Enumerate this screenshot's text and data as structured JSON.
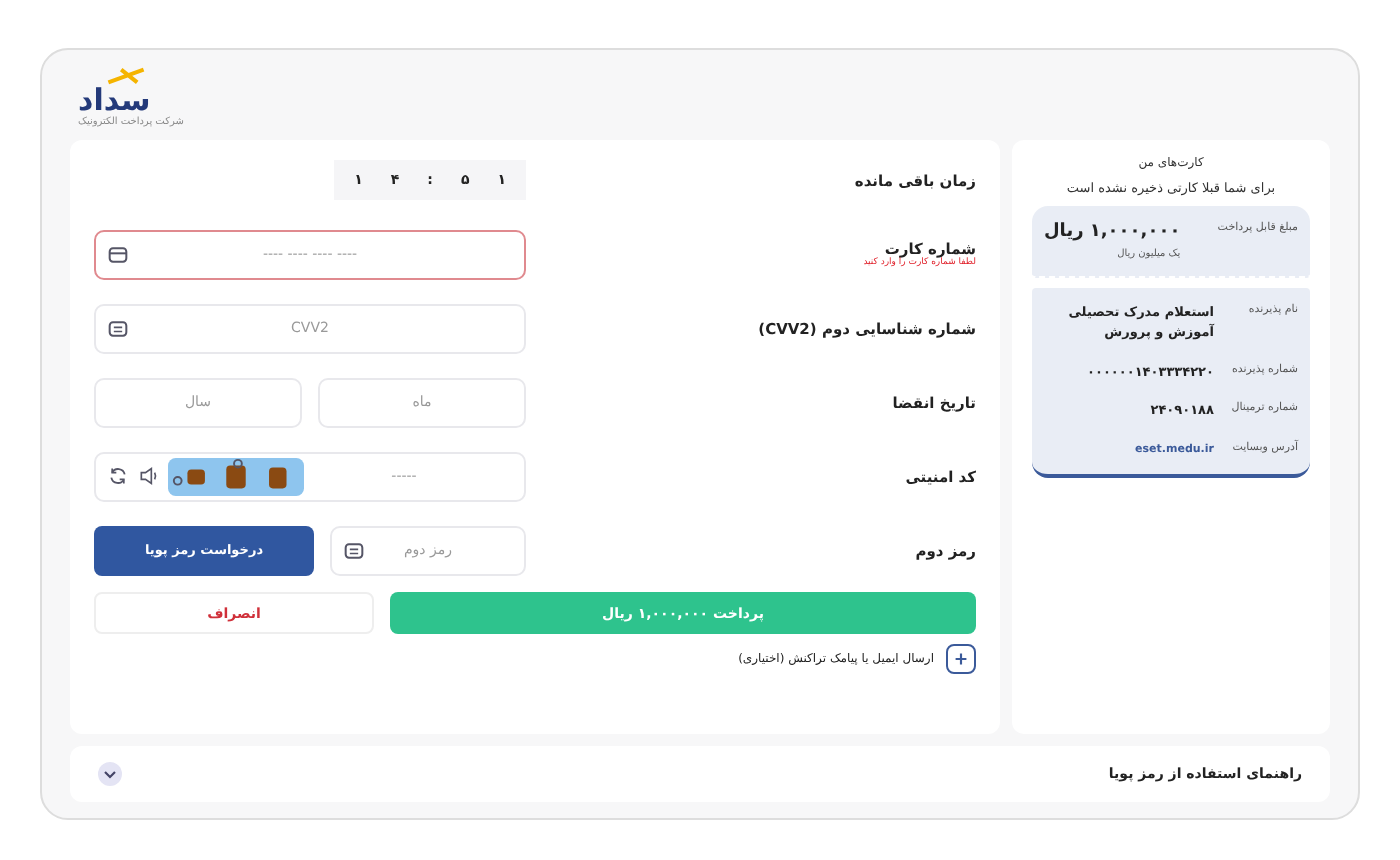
{
  "logo": {
    "name": "سداد",
    "subtitle": "شرکت پرداخت الکترونیک"
  },
  "saved_cards": {
    "title": "کارت‌های من",
    "message": "برای شما قبلا کارتی ذخیره نشده است"
  },
  "invoice": {
    "amount_label": "مبلغ قابل پرداخت",
    "amount": "۱,۰۰۰,۰۰۰ ریال",
    "amount_words": "یک میلیون ریال",
    "rows": [
      {
        "label": "نام پذیرنده",
        "value": "استعلام مدرک تحصیلی آموزش و پرورش",
        "kind": "text"
      },
      {
        "label": "شماره پذیرنده",
        "value": "۰۰۰۰۰۰۱۴۰۳۳۳۴۲۲۰",
        "kind": "text"
      },
      {
        "label": "شماره ترمینال",
        "value": "۲۴۰۹۰۱۸۸",
        "kind": "text"
      },
      {
        "label": "آدرس وبسایت",
        "value": "eset.medu.ir",
        "kind": "link"
      }
    ]
  },
  "timer": {
    "label": "زمان باقی مانده",
    "digits": [
      "۱",
      "۵",
      ":",
      "۴",
      "۱"
    ]
  },
  "card_number": {
    "label": "شماره کارت",
    "placeholder": "---- ---- ---- ----",
    "error": true,
    "error_text": "لطفا شماره کارت را وارد کنید"
  },
  "cvv2": {
    "label": "شماره شناسایی دوم (CVV2)",
    "placeholder": "CVV2"
  },
  "expiry": {
    "label": "تاریخ انقضا",
    "month_placeholder": "ماه",
    "year_placeholder": "سال"
  },
  "captcha": {
    "label": "کد امنیتی",
    "placeholder": "-----"
  },
  "second_password": {
    "label": "رمز دوم",
    "placeholder": "رمز دوم",
    "request_button": "درخواست رمز پویا"
  },
  "pay_button": "پرداخت ۱,۰۰۰,۰۰۰ ریال",
  "cancel_button": "انصراف",
  "send_receipt": "ارسال ایمیل یا پیامک تراکنش (اختیاری)",
  "help": {
    "title": "راهنمای استفاده از رمز پویا",
    "expanded": false
  }
}
